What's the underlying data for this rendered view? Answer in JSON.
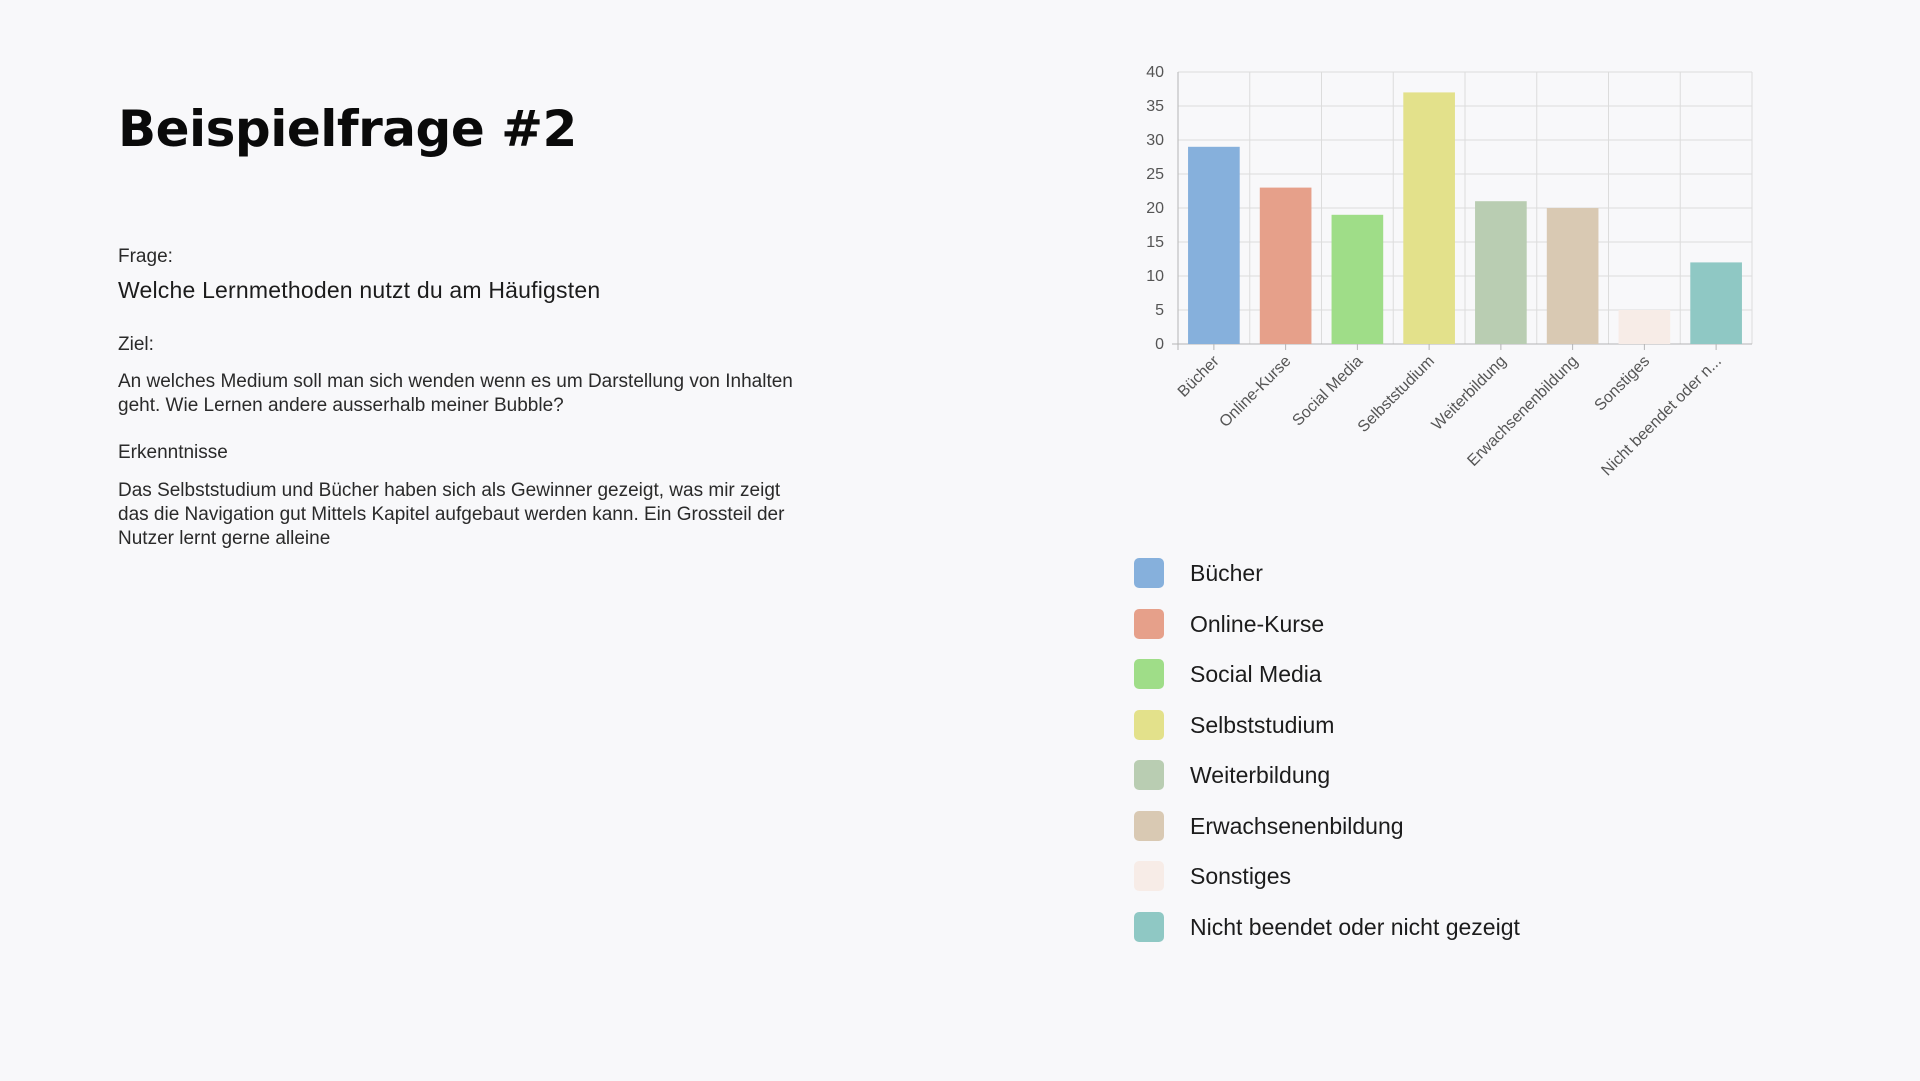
{
  "page": {
    "title": "Beispielfrage #2",
    "frage_label": "Frage:",
    "frage_text": "Welche Lernmethoden nutzt du am Häufigsten",
    "ziel_label": "Ziel:",
    "ziel_text": "An welches Medium soll man sich wenden wenn es um Darstellung von Inhalten geht. Wie Lernen andere ausserhalb meiner Bubble?",
    "erkenntnisse_label": "Erkenntnisse",
    "erkenntnisse_text": "Das Selbststudium und Bücher haben sich als Gewinner gezeigt, was mir zeigt das die Navigation gut Mittels Kapitel aufgebaut werden kann. Ein Grossteil der Nutzer lernt gerne alleine"
  },
  "chart_data": {
    "type": "bar",
    "title": "",
    "xlabel": "",
    "ylabel": "",
    "ylim": [
      0,
      40
    ],
    "yticks": [
      0,
      5,
      10,
      15,
      20,
      25,
      30,
      35,
      40
    ],
    "grid": true,
    "legend_position": "bottom-left",
    "categories": [
      "Bücher",
      "Online-Kurse",
      "Social Media",
      "Selbststudium",
      "Weiterbildung",
      "Erwachsenenbildung",
      "Sonstiges",
      "Nicht beendet oder n..."
    ],
    "legend_labels": [
      "Bücher",
      "Online-Kurse",
      "Social Media",
      "Selbststudium",
      "Weiterbildung",
      "Erwachsenenbildung",
      "Sonstiges",
      "Nicht beendet oder nicht gezeigt"
    ],
    "values": [
      29,
      23,
      19,
      37,
      21,
      20,
      5,
      12
    ],
    "colors": [
      "#86b0dc",
      "#e6a08a",
      "#9fdd88",
      "#e3e18b",
      "#b9cdb2",
      "#d9c9b3",
      "#f7ece7",
      "#8fc8c4"
    ]
  }
}
